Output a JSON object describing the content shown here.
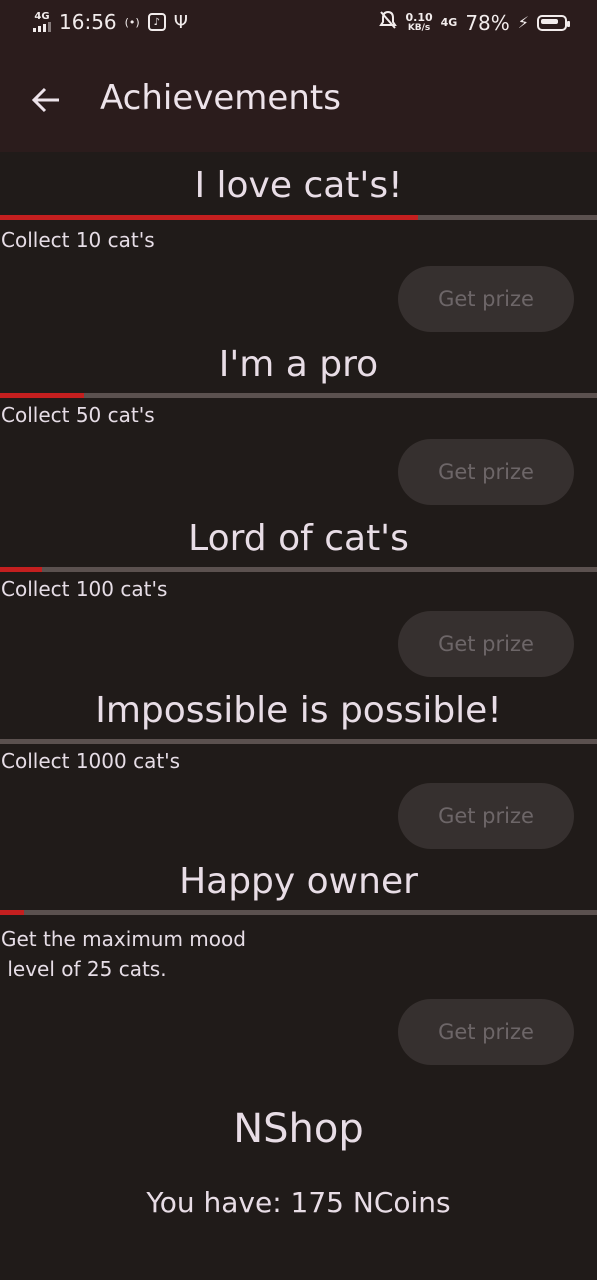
{
  "status_bar": {
    "network_type": "4G",
    "time": "16:56",
    "hotspot_glyph": "(•)",
    "data_rate": "0.10",
    "data_rate_unit": "KB/s",
    "network_type_2": "4G",
    "battery_percent": "78%",
    "battery_level": 0.78
  },
  "app_bar": {
    "title": "Achievements",
    "back_icon": "arrow-left-icon"
  },
  "achievements": [
    {
      "title": "I love cat's!",
      "description": "Collect 10 cat's",
      "progress": 0.7,
      "button": "Get prize"
    },
    {
      "title": "I'm a pro",
      "description": "Collect 50 cat's",
      "progress": 0.14,
      "button": "Get prize"
    },
    {
      "title": "Lord of cat's",
      "description": "Collect 100 cat's",
      "progress": 0.07,
      "button": "Get prize"
    },
    {
      "title": "Impossible is possible!",
      "description": "Collect 1000 cat's",
      "progress": 0.0,
      "button": "Get prize"
    },
    {
      "title": "Happy owner",
      "description": "Get the maximum mood\n level of 25 cats.",
      "progress": 0.04,
      "button": "Get prize"
    }
  ],
  "shop": {
    "title": "NShop",
    "balance_text": "You have: 175 NCoins"
  },
  "colors": {
    "progress_fill": "#c41f1f",
    "progress_track": "#5b514f",
    "app_bar": "#2b1c1c",
    "background": "#201b19"
  }
}
